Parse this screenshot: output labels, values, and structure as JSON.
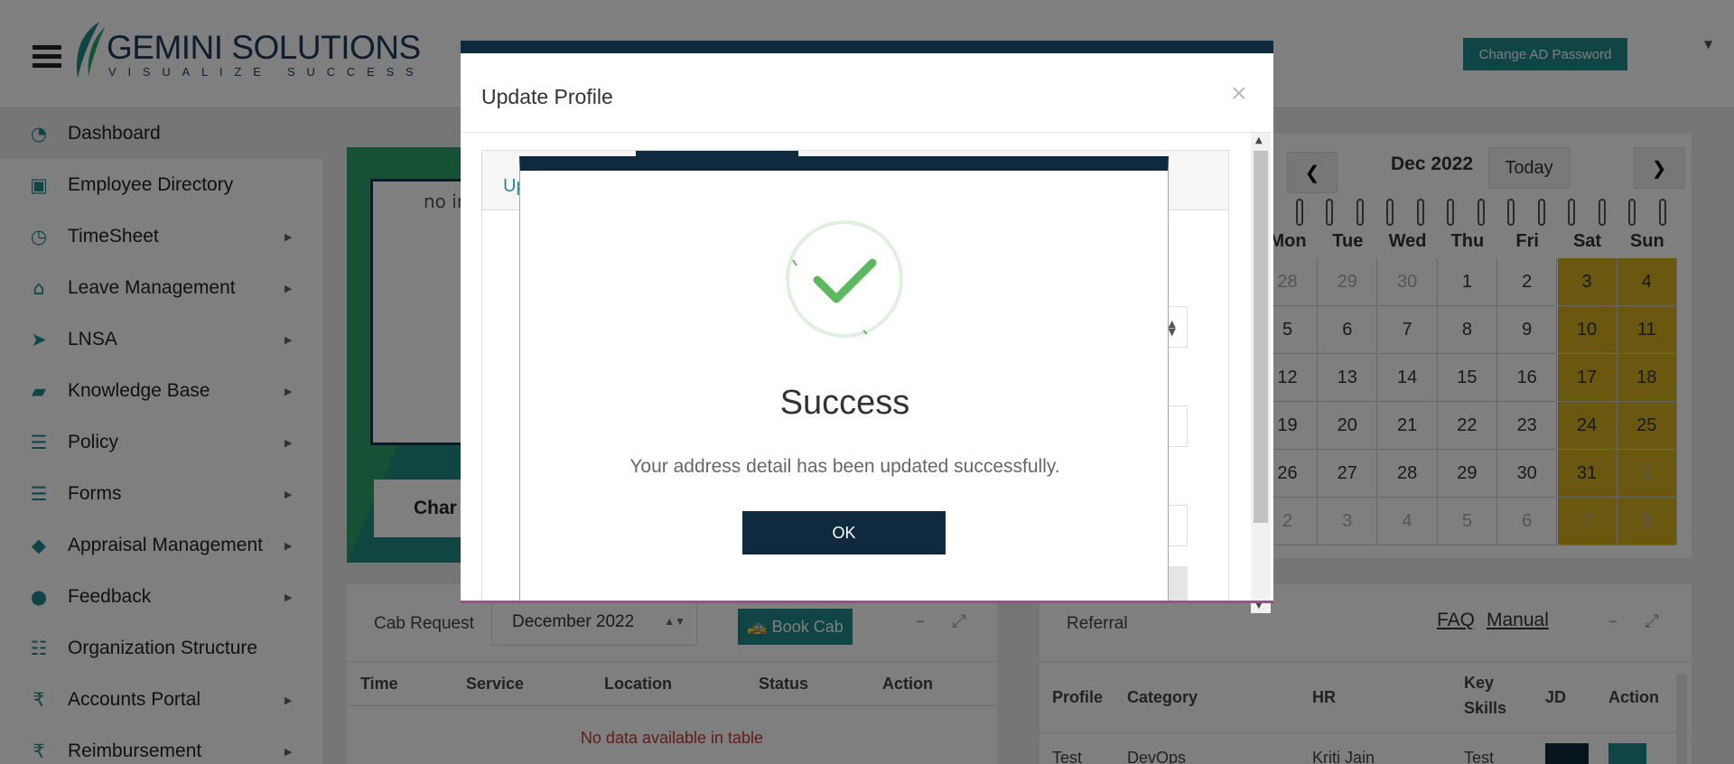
{
  "header": {
    "logo_main_bold": "GEMINI",
    "logo_main_rest": " SOLUTIONS",
    "logo_sub": "VISUALIZE SUCCESS",
    "change_password": "Change AD Password"
  },
  "sidebar": {
    "items": [
      {
        "label": "Dashboard",
        "icon": "dashboard-icon",
        "glyph": "◔",
        "chevron": false
      },
      {
        "label": "Employee Directory",
        "icon": "contact-card-icon",
        "glyph": "▣",
        "chevron": false
      },
      {
        "label": "TimeSheet",
        "icon": "clock-icon",
        "glyph": "◷",
        "chevron": true
      },
      {
        "label": "Leave Management",
        "icon": "home-icon",
        "glyph": "⌂",
        "chevron": true
      },
      {
        "label": "LNSA",
        "icon": "paper-plane-icon",
        "glyph": "➤",
        "chevron": true
      },
      {
        "label": "Knowledge Base",
        "icon": "folder-open-icon",
        "glyph": "▰",
        "chevron": true
      },
      {
        "label": "Policy",
        "icon": "document-icon",
        "glyph": "☰",
        "chevron": true
      },
      {
        "label": "Forms",
        "icon": "document-icon",
        "glyph": "☰",
        "chevron": true
      },
      {
        "label": "Appraisal Management",
        "icon": "graduation-cap-icon",
        "glyph": "◆",
        "chevron": true
      },
      {
        "label": "Feedback",
        "icon": "chat-bubbles-icon",
        "glyph": "●",
        "chevron": true
      },
      {
        "label": "Organization Structure",
        "icon": "sitemap-icon",
        "glyph": "☷",
        "chevron": false
      },
      {
        "label": "Accounts Portal",
        "icon": "rupee-icon",
        "glyph": "₹",
        "chevron": true
      },
      {
        "label": "Reimbursement",
        "icon": "rupee-icon",
        "glyph": "₹",
        "chevron": true
      }
    ]
  },
  "profile_card": {
    "image_alt": "no in",
    "name_partial": "Char"
  },
  "cab": {
    "title": "Cab Request",
    "month": "December 2022",
    "book_label": "Book Cab",
    "columns": [
      "Time",
      "Service",
      "Location",
      "Status",
      "Action"
    ],
    "empty": "No data available in table"
  },
  "calendar": {
    "month": "Dec 2022",
    "today": "Today",
    "prev": "❮",
    "next": "❯",
    "days_of_week": [
      "Mon",
      "Tue",
      "Wed",
      "Thu",
      "Fri",
      "Sat",
      "Sun"
    ],
    "weeks": [
      [
        "28",
        "29",
        "30",
        "1",
        "2",
        "3",
        "4"
      ],
      [
        "5",
        "6",
        "7",
        "8",
        "9",
        "10",
        "11"
      ],
      [
        "12",
        "13",
        "14",
        "15",
        "16",
        "17",
        "18"
      ],
      [
        "19",
        "20",
        "21",
        "22",
        "23",
        "24",
        "25"
      ],
      [
        "26",
        "27",
        "28",
        "29",
        "30",
        "31",
        "1"
      ],
      [
        "2",
        "3",
        "4",
        "5",
        "6",
        "7",
        "8"
      ]
    ]
  },
  "referral": {
    "title": "Referral",
    "faq": "FAQ",
    "manual": "Manual",
    "columns": [
      "Profile",
      "Category",
      "HR",
      "Key Skills",
      "JD",
      "Action"
    ],
    "row": [
      "Test",
      "DevOps",
      "Kriti Jain",
      "Test"
    ]
  },
  "modal": {
    "title": "Update Profile",
    "close": "×",
    "tab_partial": "Up"
  },
  "alert": {
    "title": "Success",
    "message": "Your address detail has been updated successfully.",
    "ok": "OK"
  },
  "colors": {
    "brand_teal": "#1f8b8b",
    "navy": "#0f2a3e",
    "success_green": "#5cb85c",
    "weekend_gold": "#d4b120"
  }
}
